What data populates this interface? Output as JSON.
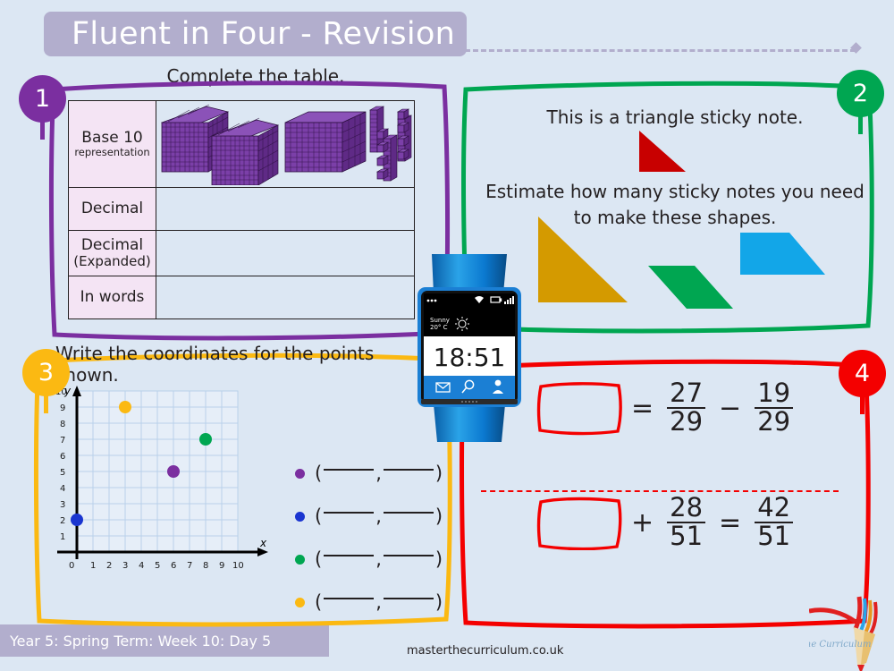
{
  "header": {
    "title": "Fluent in Four - Revision"
  },
  "sections": {
    "s1": {
      "badge": "1",
      "badge_color": "#7b2fa0",
      "heading": "Complete the table.",
      "table": {
        "rows": [
          {
            "label": "Base 10",
            "sublabel": "representation",
            "value": ""
          },
          {
            "label": "Decimal",
            "sublabel": "",
            "value": ""
          },
          {
            "label": "Decimal",
            "sublabel2": "(Expanded)",
            "value": ""
          },
          {
            "label": "In words",
            "sublabel": "",
            "value": ""
          }
        ]
      },
      "base10": {
        "thousands": 2,
        "hundreds": 1,
        "tens": 3,
        "ones": 8,
        "color": "#7b3fa8"
      }
    },
    "s2": {
      "badge": "2",
      "badge_color": "#00a651",
      "line1": "This is a triangle sticky note.",
      "line2": "Estimate how many sticky notes you need to make these shapes.",
      "shapes": [
        {
          "name": "red-triangle-note",
          "color": "#c80000"
        },
        {
          "name": "gold-triangle",
          "color": "#d49a00"
        },
        {
          "name": "green-parallelogram",
          "color": "#00a651"
        },
        {
          "name": "blue-trapezium",
          "color": "#12a6e8"
        }
      ]
    },
    "s3": {
      "badge": "3",
      "badge_color": "#fbb912",
      "heading": "Write the coordinates for the points shown.",
      "axis": {
        "xlabel": "x",
        "ylabel": "y",
        "origin": "0",
        "xticks": [
          "1",
          "2",
          "3",
          "4",
          "5",
          "6",
          "7",
          "8",
          "9",
          "10"
        ],
        "yticks": [
          "1",
          "2",
          "3",
          "4",
          "5",
          "6",
          "7",
          "8",
          "9",
          "10"
        ]
      },
      "points": [
        {
          "name": "yellow-point",
          "color": "#fbb912",
          "x": 3,
          "y": 9
        },
        {
          "name": "green-point",
          "color": "#00a651",
          "x": 8,
          "y": 7
        },
        {
          "name": "purple-point",
          "color": "#7b2fa0",
          "x": 6,
          "y": 5
        },
        {
          "name": "blue-point",
          "color": "#1a35d0",
          "x": 0,
          "y": 2
        }
      ],
      "answers": [
        {
          "color": "#7b2fa0",
          "x_value": "",
          "y_value": ""
        },
        {
          "color": "#1a35d0",
          "x_value": "",
          "y_value": ""
        },
        {
          "color": "#00a651",
          "x_value": "",
          "y_value": ""
        },
        {
          "color": "#fbb912",
          "x_value": "",
          "y_value": ""
        }
      ],
      "open_paren": "(",
      "comma": ",",
      "close_paren": ")"
    },
    "s4": {
      "badge": "4",
      "badge_color": "#f40000",
      "equations": [
        {
          "box_position": "left",
          "op1": "=",
          "frac1": {
            "num": "27",
            "den": "29"
          },
          "op2": "−",
          "frac2": {
            "num": "19",
            "den": "29"
          }
        },
        {
          "box_position": "left",
          "op1": "+",
          "frac1": {
            "num": "28",
            "den": "51"
          },
          "op2": "=",
          "frac2": {
            "num": "42",
            "den": "51"
          }
        }
      ]
    }
  },
  "watch": {
    "time": "18:51",
    "weather_line1": "Sunny",
    "weather_line2": "20° C",
    "status_icons": [
      "wifi-icon",
      "battery-icon",
      "signal-icon"
    ],
    "nav_icons": [
      "mail-icon",
      "search-icon",
      "contact-icon"
    ],
    "band_color": "#0b79d0",
    "screen_color": "#ffffff"
  },
  "footer": {
    "label": "Year 5: Spring Term: Week 10: Day 5",
    "url": "masterthecurriculum.co.uk",
    "logo_text": "Master The Curriculum"
  }
}
